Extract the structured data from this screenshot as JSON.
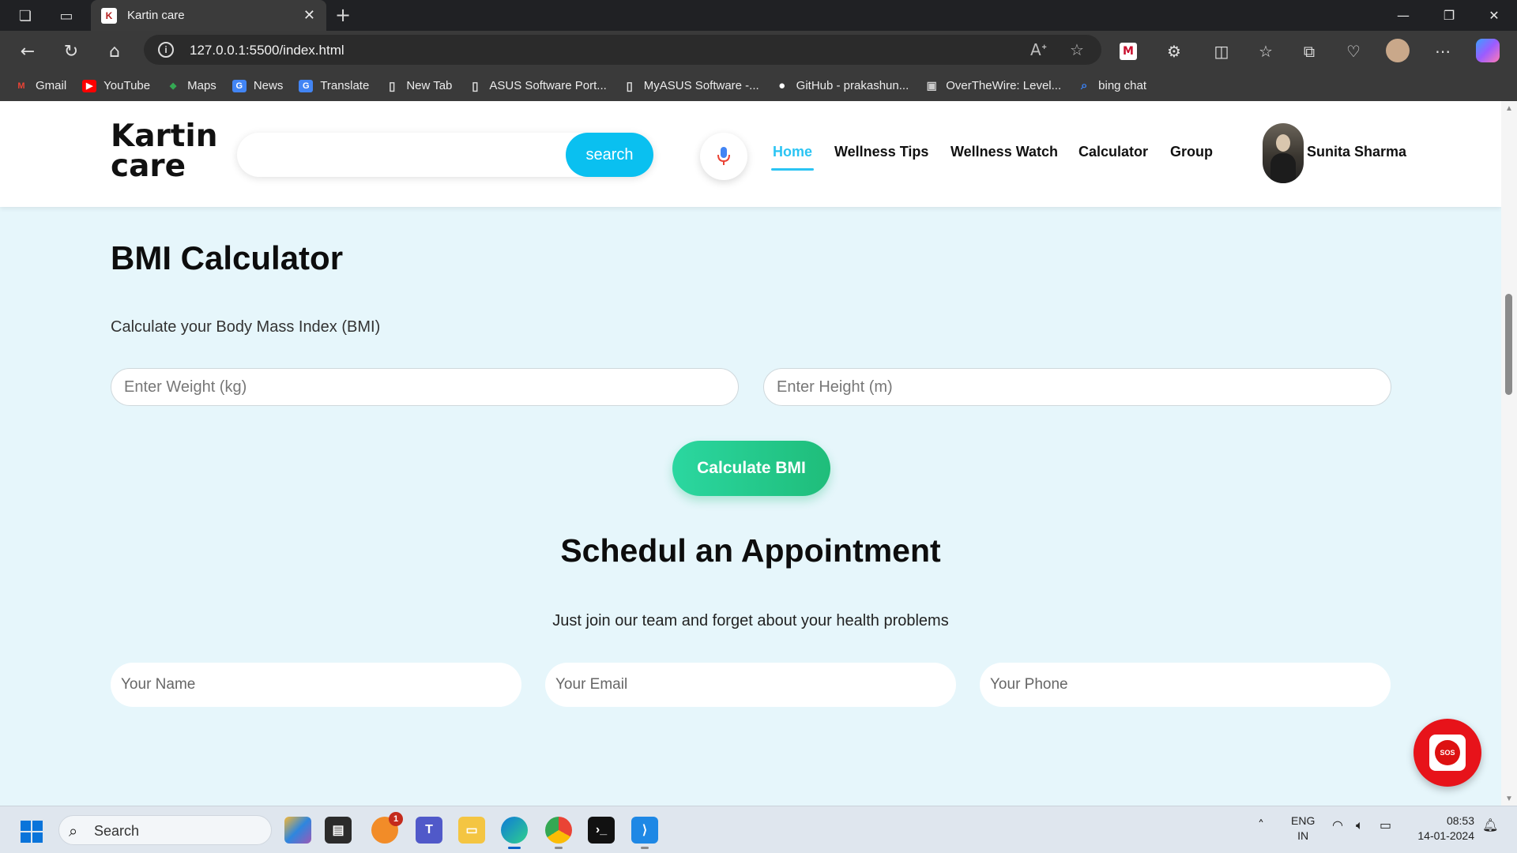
{
  "browser": {
    "tab_title": "Kartin care",
    "tab_favicon": "K",
    "url": "127.0.0.1:5500/index.html",
    "bookmarks": [
      {
        "label": "Gmail",
        "icon": "gmail-icon",
        "color": "#ea4335",
        "glyph": "M"
      },
      {
        "label": "YouTube",
        "icon": "youtube-icon",
        "color": "#ff0000",
        "glyph": "▶"
      },
      {
        "label": "Maps",
        "icon": "maps-icon",
        "color": "#34a853",
        "glyph": "◆"
      },
      {
        "label": "News",
        "icon": "news-icon",
        "color": "#4285f4",
        "glyph": "G"
      },
      {
        "label": "Translate",
        "icon": "translate-icon",
        "color": "#4285f4",
        "glyph": "G"
      },
      {
        "label": "New Tab",
        "icon": "page-icon",
        "color": "transparent",
        "glyph": "▯"
      },
      {
        "label": "ASUS Software Port...",
        "icon": "page-icon",
        "color": "transparent",
        "glyph": "▯"
      },
      {
        "label": "MyASUS Software -...",
        "icon": "page-icon",
        "color": "transparent",
        "glyph": "▯"
      },
      {
        "label": "GitHub - prakashun...",
        "icon": "github-icon",
        "color": "#111111",
        "glyph": "●"
      },
      {
        "label": "OverTheWire: Level...",
        "icon": "overthewire-icon",
        "color": "#555555",
        "glyph": "▣"
      },
      {
        "label": "bing chat",
        "icon": "bing-icon",
        "color": "transparent",
        "glyph": "⌕"
      }
    ]
  },
  "site": {
    "logo": "Kartin care",
    "search_placeholder": "",
    "search_label": "search",
    "nav": [
      {
        "label": "Home",
        "active": true
      },
      {
        "label": "Wellness Tips",
        "active": false
      },
      {
        "label": "Wellness Watch",
        "active": false
      },
      {
        "label": "Calculator",
        "active": false
      },
      {
        "label": "Group",
        "active": false
      }
    ],
    "user_name": "Sunita Sharma",
    "accent_color": "#2bc4f3"
  },
  "bmi": {
    "title": "BMI Calculator",
    "subtitle": "Calculate your Body Mass Index (BMI)",
    "weight_placeholder": "Enter Weight (kg)",
    "height_placeholder": "Enter Height (m)",
    "button_label": "Calculate BMI"
  },
  "appointment": {
    "title": "Schedul an Appointment",
    "subtitle": "Just join our team and forget about your health problems",
    "name_placeholder": "Your Name",
    "email_placeholder": "Your Email",
    "phone_placeholder": "Your Phone"
  },
  "sos_label": "SOS",
  "taskbar": {
    "search_label": "Search",
    "notification_count": "1",
    "lang_line1": "ENG",
    "lang_line2": "IN",
    "time": "08:53",
    "date": "14-01-2024"
  }
}
